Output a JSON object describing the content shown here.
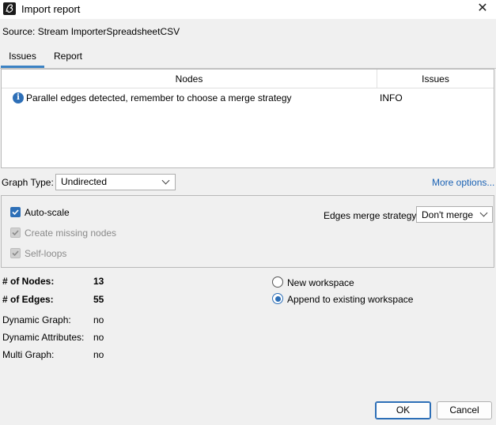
{
  "window": {
    "title": "Import report",
    "close_glyph": "✕"
  },
  "source": {
    "label": "Source:",
    "value": "Stream ImporterSpreadsheetCSV"
  },
  "tabs": [
    {
      "label": "Issues",
      "selected": true
    },
    {
      "label": "Report",
      "selected": false
    }
  ],
  "table": {
    "columns": [
      "Nodes",
      "Issues"
    ],
    "rows": [
      {
        "icon": "info-icon",
        "message": "Parallel edges detected, remember to choose a merge strategy",
        "level": "INFO"
      }
    ]
  },
  "graph_type": {
    "label": "Graph Type:",
    "value": "Undirected"
  },
  "more_options": "More options...",
  "options": {
    "auto_scale": {
      "label": "Auto-scale",
      "checked": true,
      "enabled": true
    },
    "create_missing_nodes": {
      "label": "Create missing nodes",
      "checked": true,
      "enabled": false
    },
    "self_loops": {
      "label": "Self-loops",
      "checked": true,
      "enabled": false
    },
    "edges_merge": {
      "label": "Edges merge strategy:",
      "value": "Don't merge"
    }
  },
  "stats": {
    "nodes": {
      "label": "# of Nodes:",
      "value": "13"
    },
    "edges": {
      "label": "# of Edges:",
      "value": "55"
    },
    "dynamic_graph": {
      "label": "Dynamic Graph:",
      "value": "no"
    },
    "dynamic_attributes": {
      "label": "Dynamic Attributes:",
      "value": "no"
    },
    "multi_graph": {
      "label": "Multi Graph:",
      "value": "no"
    }
  },
  "workspace": {
    "new": {
      "label": "New workspace",
      "selected": false
    },
    "append": {
      "label": "Append to existing workspace",
      "selected": true
    }
  },
  "buttons": {
    "ok": "OK",
    "cancel": "Cancel"
  },
  "colors": {
    "accent": "#2d6fb7",
    "link": "#1a62b4"
  }
}
